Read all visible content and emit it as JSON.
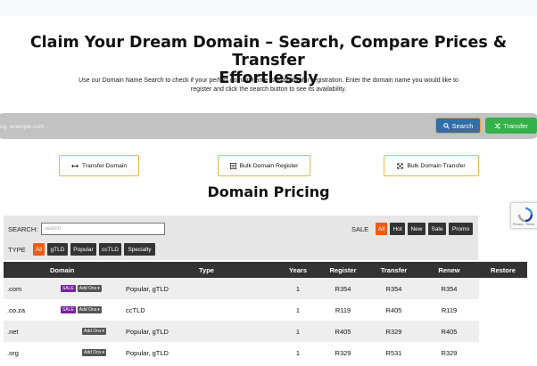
{
  "hero": {
    "title_line1": "Claim Your Dream Domain – Search, Compare Prices & Transfer",
    "title_line2": "Effortlessly",
    "subtitle_line1": "Use our Domain Name Search to check if your perfect domain name is available for registration. Enter the domain name you would like to",
    "subtitle_line2": "register and click the search button to see its availability."
  },
  "search": {
    "placeholder": "eg. example.com",
    "value": "",
    "search_label": "Search",
    "transfer_label": "Transfer"
  },
  "actions": {
    "transfer_domain": "Transfer Domain",
    "bulk_register": "Bulk Domain Register",
    "bulk_transfer": "Bulk Domain Transfer"
  },
  "pricing": {
    "title": "Domain Pricing",
    "search_label": "SEARCH:",
    "search_placeholder": "search",
    "sale_label": "SALE",
    "sale_chips": [
      "All",
      "Hot",
      "New",
      "Sale",
      "Promo"
    ],
    "sale_active": "All",
    "type_label": "TYPE",
    "type_chips": [
      "All",
      "gTLD",
      "Popular",
      "ccTLD",
      "Specialty"
    ],
    "type_active": "All",
    "columns": [
      "Domain",
      "Type",
      "Years",
      "Register",
      "Transfer",
      "Renew",
      "Restore"
    ],
    "rows": [
      {
        "domain": ".com",
        "sale": "SALE",
        "addons": "Add Ons",
        "type": "Popular, gTLD",
        "years": "1",
        "register": "R354",
        "transfer": "R354",
        "renew": "R354",
        "restore": ""
      },
      {
        "domain": ".co.za",
        "sale": "SALE",
        "addons": "Add Ons",
        "type": "ccTLD",
        "years": "1",
        "register": "R119",
        "transfer": "R405",
        "renew": "R119",
        "restore": ""
      },
      {
        "domain": ".net",
        "sale": "",
        "addons": "Add Ons",
        "type": "Popular, gTLD",
        "years": "1",
        "register": "R405",
        "transfer": "R329",
        "renew": "R405",
        "restore": ""
      },
      {
        "domain": ".org",
        "sale": "",
        "addons": "Add Ons",
        "type": "Popular, gTLD",
        "years": "1",
        "register": "R329",
        "transfer": "R531",
        "renew": "R329",
        "restore": ""
      }
    ]
  },
  "recaptcha": {
    "text": "Privacy - Terms"
  },
  "colors": {
    "search_button": "#2f6ea8",
    "transfer_button": "#33b249",
    "action_border": "#f1b541",
    "active_chip": "#f05a15",
    "sale_tag": "#7a1fa2",
    "table_header": "#333333"
  }
}
